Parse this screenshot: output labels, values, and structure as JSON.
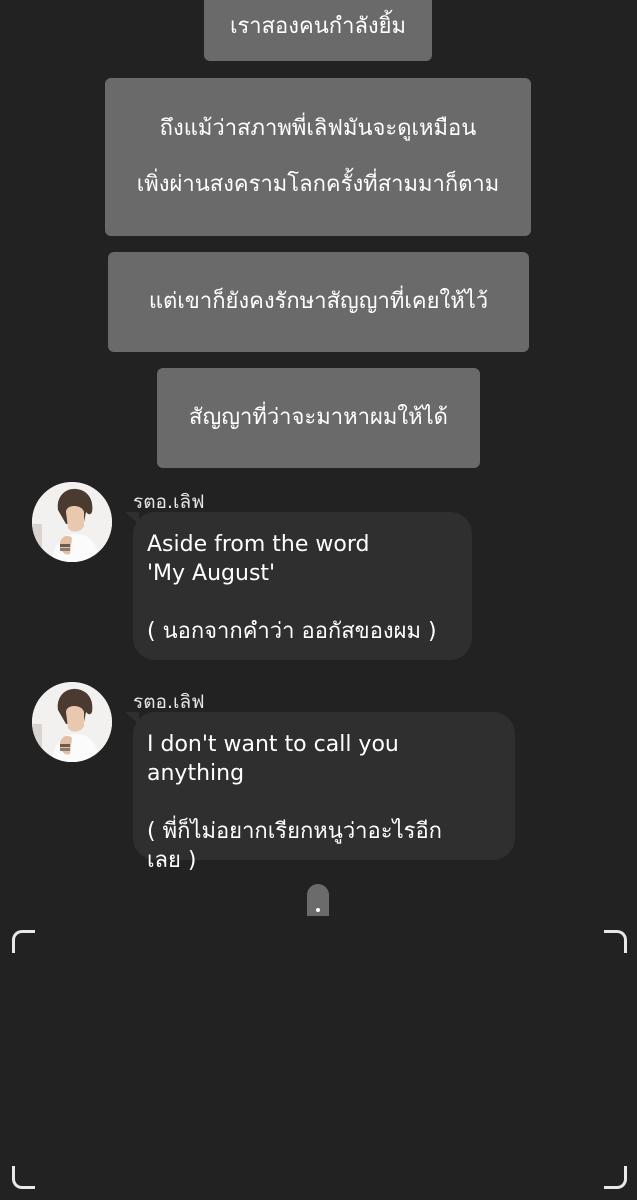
{
  "narration": [
    [
      "เราสองคนกำลังยิ้ม"
    ],
    [
      "ถึงแม้ว่าสภาพพี่เลิฟมันจะดูเหมือน",
      "เพิ่งผ่านสงครามโลกครั้งที่สามมาก็ตาม"
    ],
    [
      "แต่เขาก็ยังคงรักษาสัญญาที่เคยให้ไว้"
    ],
    [
      "สัญญาที่ว่าจะมาหาผมให้ได้"
    ]
  ],
  "messages": [
    {
      "sender": "รตอ.เลิฟ",
      "avatar": "avatar-photo",
      "lines": [
        "Aside from the word",
        "'My August'",
        "",
        "( นอกจากคำว่า ออกัสของผม )"
      ]
    },
    {
      "sender": "รตอ.เลิฟ",
      "avatar": "avatar-photo",
      "lines": [
        "I don't want to call you anything",
        "",
        "( พี่ก็ไม่อยากเรียกหนูว่าอะไรอีก",
        "เลย )"
      ]
    }
  ],
  "typing_indicator": ".",
  "colors": {
    "background": "#222222",
    "narration_box": "#6a6a6a",
    "bubble": "#2f2f2f",
    "text": "#ffffff"
  }
}
